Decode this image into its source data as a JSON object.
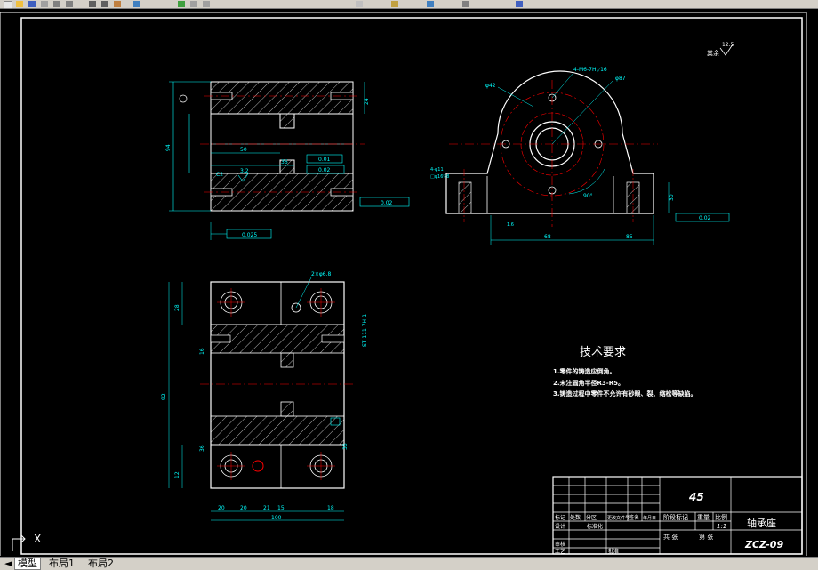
{
  "tech": {
    "title": "技术要求",
    "items": [
      "1.零件的铸造应倒角。",
      "2.未注圆角半径R3-R5。",
      "3.铸造过程中零件不允许有砂眼、裂、缩松等缺陷。"
    ]
  },
  "title_block": {
    "material": "45",
    "part_name": "轴承座",
    "drawing_no": "ZCZ-09",
    "scale_label": "比例",
    "scale": "1:1",
    "stage_label": "阶段标记",
    "weight_label": "重量",
    "sheet_total": "共 张",
    "sheet_no": "第 张",
    "mark": "标记",
    "count": "处数",
    "zone": "分区",
    "change_doc": "更改文件号",
    "sign": "签名",
    "date": "年月日",
    "design": "设计",
    "review": "审核",
    "process": "工艺",
    "approve": "批准",
    "standardize": "标准化"
  },
  "annotations": {
    "roughness_rest": "其余",
    "roughness_rest_val": "12.5",
    "thread_holes": "4-M6-7H▽16",
    "dia_87": "φ87",
    "dia_42": "φ42",
    "angle_90": "90°",
    "hole_spec": "4-φ11",
    "cb_spec": "□φ16▽8",
    "dim_50_front": "50",
    "dim_36_front": "36",
    "dim_c2": "C2",
    "dim_3_2": "3.2",
    "gtol_1": "0.01",
    "gtol_2": "0.02",
    "gtol_3": "0.02",
    "gtol_4": "0.025",
    "gtol_5": "0.02",
    "gtol_6": "0.03",
    "datum_a": "A",
    "dim_85": "85",
    "dim_68": "68",
    "dim_ra16": "1.6",
    "dim_16_top": "16",
    "dim_100": "100",
    "dim_20": "20",
    "dim_20b": "20",
    "dim_21": "21",
    "dim_15": "15",
    "dim_18": "18",
    "dim_36": "36",
    "dim_36b": "36",
    "dim_50": "50",
    "dim_92": "92",
    "dim_28": "28",
    "dim_30": "30",
    "dim_12": "12",
    "dim_94": "94",
    "dim_24": "24",
    "top_note": "2×φ6.8",
    "side_label": "ST 111 7H-1",
    "ucs_x": "X"
  },
  "tabs": [
    "模型",
    "布局1",
    "布局2"
  ],
  "colors": {
    "background": "#000000",
    "outline": "#ffffff",
    "dimension": "#00ffff",
    "center": "#ff0000",
    "border": "#ffffff",
    "toolbar": "#d4d0c8",
    "hatch": "#ffffff"
  }
}
